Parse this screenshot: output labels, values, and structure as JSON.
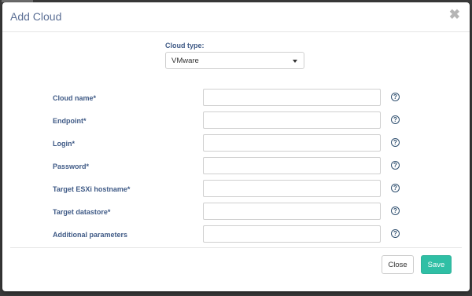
{
  "dialog": {
    "title": "Add Cloud",
    "close_glyph": "✖"
  },
  "cloud_type": {
    "label": "Cloud type:",
    "selected": "VMware"
  },
  "fields": [
    {
      "label": "Cloud name*",
      "value": "",
      "help": "?"
    },
    {
      "label": "Endpoint*",
      "value": "",
      "help": "?"
    },
    {
      "label": "Login*",
      "value": "",
      "help": "?"
    },
    {
      "label": "Password*",
      "value": "",
      "help": "?"
    },
    {
      "label": "Target ESXi hostname*",
      "value": "",
      "help": "?"
    },
    {
      "label": "Target datastore*",
      "value": "",
      "help": "?"
    },
    {
      "label": "Additional parameters",
      "value": "",
      "help": "?"
    }
  ],
  "footer": {
    "close_label": "Close",
    "save_label": "Save"
  },
  "colors": {
    "title": "#5b6f95",
    "label": "#3f5a86",
    "save_button": "#2fbfa5",
    "help_icon": "#2f4f6f"
  },
  "icons": {
    "close": "close-icon",
    "caret": "caret-down-icon",
    "help": "help-icon"
  }
}
